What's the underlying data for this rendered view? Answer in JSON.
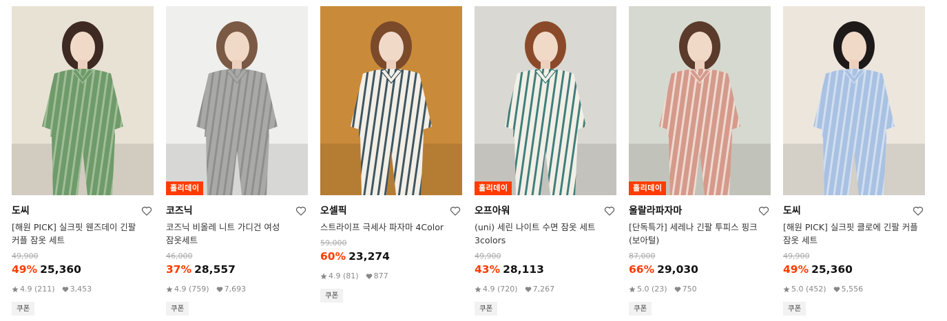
{
  "products": [
    {
      "brand": "도씨",
      "title": "[해원 PICK] 실크핏 웬즈데이 긴팔 커플 잠옷 세트",
      "badge": "",
      "original_price": "49,900",
      "discount": "49%",
      "price": "25,360",
      "rating": "4.9",
      "reviews": "(211)",
      "likes": "3,453",
      "coupon": "쿠폰",
      "image": {
        "bg": "#e8e2d5",
        "main": "#6f9a6a",
        "accent": "#3e2a22",
        "stripe": "#a8c5a0"
      }
    },
    {
      "brand": "코즈닉",
      "title": "코즈닉 비올레 니트 가디건 여성 잠옷세트",
      "badge": "홀리데이",
      "original_price": "46,000",
      "discount": "37%",
      "price": "28,557",
      "rating": "4.9",
      "reviews": "(759)",
      "likes": "7,693",
      "coupon": "쿠폰",
      "image": {
        "bg": "#efefee",
        "main": "#a9a9a7",
        "accent": "#7a5a44",
        "stripe": "#8a8a88"
      }
    },
    {
      "brand": "오셀픽",
      "title": "스트라이프 극세사 파자마 4Color",
      "badge": "",
      "original_price": "59,000",
      "discount": "60%",
      "price": "23,274",
      "rating": "4.9",
      "reviews": "(81)",
      "likes": "877",
      "coupon": "쿠폰",
      "image": {
        "bg": "#c98a3a",
        "main": "#f3efe6",
        "accent": "#7a4a2a",
        "stripe": "#1e3a4a"
      }
    },
    {
      "brand": "오프아워",
      "title": "(uni) 세린 나이트 수면 잠옷 세트 3colors",
      "badge": "홀리데이",
      "original_price": "49,900",
      "discount": "43%",
      "price": "28,113",
      "rating": "4.9",
      "reviews": "(720)",
      "likes": "7,267",
      "coupon": "쿠폰",
      "image": {
        "bg": "#d9d8d2",
        "main": "#f2efe6",
        "accent": "#8a4a2a",
        "stripe": "#1f6a6a"
      }
    },
    {
      "brand": "울랄라파자마",
      "title": "[단독특가] 세레나 긴팔 투피스 핑크(보아털)",
      "badge": "홀리데이",
      "original_price": "87,000",
      "discount": "66%",
      "price": "29,030",
      "rating": "5.0",
      "reviews": "(23)",
      "likes": "750",
      "coupon": "쿠폰",
      "image": {
        "bg": "#d6d9cf",
        "main": "#d59a8c",
        "accent": "#5a3a2a",
        "stripe": "#f3e6dc"
      }
    },
    {
      "brand": "도씨",
      "title": "[해원 PICK] 실크핏 클로에 긴팔 커플 잠옷 세트",
      "badge": "",
      "original_price": "49,900",
      "discount": "49%",
      "price": "25,360",
      "rating": "5.0",
      "reviews": "(452)",
      "likes": "5,556",
      "coupon": "쿠폰",
      "image": {
        "bg": "#ece6dd",
        "main": "#a9c1e2",
        "accent": "#1e1a1a",
        "stripe": "#d9e4f2"
      }
    }
  ],
  "colors": {
    "accent": "#ff3b00",
    "strike": "#aaaaaa",
    "coupon_bg": "#f2f2f2"
  }
}
